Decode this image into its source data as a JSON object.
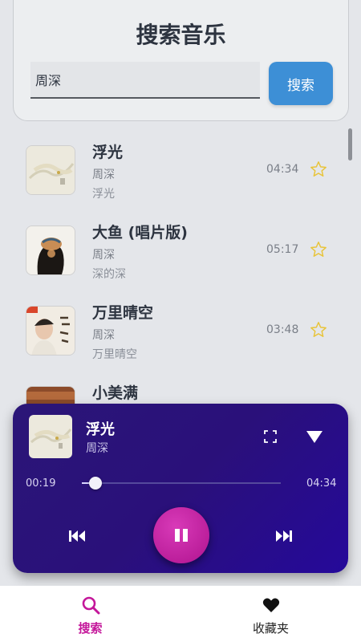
{
  "search": {
    "title": "搜索音乐",
    "input_value": "周深",
    "button_label": "搜索"
  },
  "songs": [
    {
      "title": "浮光",
      "artist": "周深",
      "album": "浮光",
      "duration": "04:34",
      "favorite_icon": "star-outline-icon"
    },
    {
      "title": "大鱼 (唱片版)",
      "artist": "周深",
      "album": "深的深",
      "duration": "05:17",
      "favorite_icon": "star-outline-icon"
    },
    {
      "title": "万里晴空",
      "artist": "周深",
      "album": "万里晴空",
      "duration": "03:48",
      "favorite_icon": "star-outline-icon"
    },
    {
      "title": "小美满",
      "artist": "",
      "album": "",
      "duration": "",
      "favorite_icon": ""
    }
  ],
  "player": {
    "title": "浮光",
    "artist": "周深",
    "current_time": "00:19",
    "total_time": "04:34",
    "progress": 0.07
  },
  "tabs": [
    {
      "label": "搜索",
      "icon": "search-icon",
      "active": true
    },
    {
      "label": "收藏夹",
      "icon": "heart-icon",
      "active": false
    }
  ],
  "colors": {
    "accent": "#c4179a",
    "search_button": "#3d8fd6",
    "player_bg": "#2a107a",
    "star": "#e8c43a"
  }
}
